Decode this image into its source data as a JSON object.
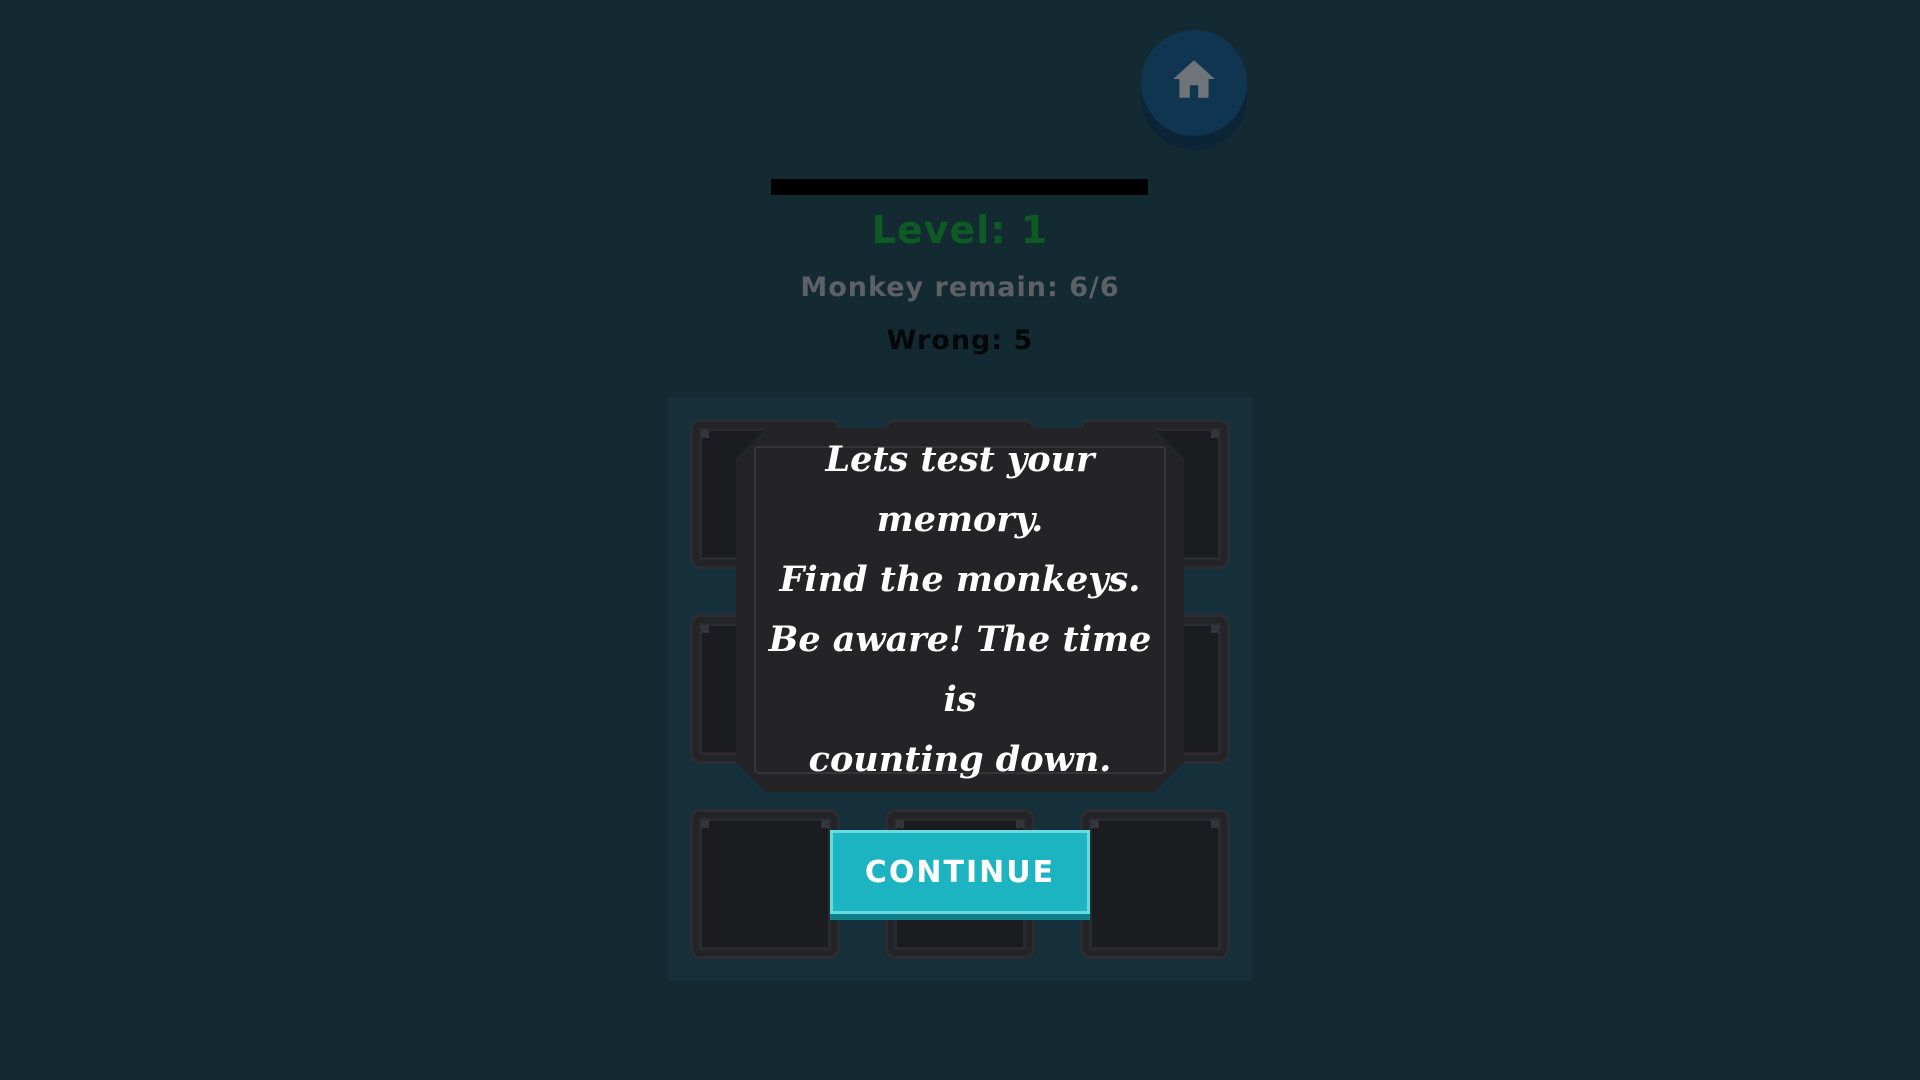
{
  "header": {
    "home_icon": "home-icon",
    "level_text": "Level: 1",
    "monkey_remain_text": "Monkey remain: 6/6",
    "wrong_text": "Wrong: 5",
    "timer_fraction": 1.0
  },
  "board": {
    "rows": 3,
    "cols": 3,
    "tile_count": 9
  },
  "dialog": {
    "lines": [
      "Lets test your",
      "memory.",
      "Find the monkeys.",
      "Be aware! The time is",
      "counting down."
    ],
    "continue_label": "CONTINUE"
  },
  "colors": {
    "background": "#132a33",
    "level": "#0e5a24",
    "remain": "#5d6165",
    "button": "#1cb4c1",
    "dialog": "#242326"
  }
}
